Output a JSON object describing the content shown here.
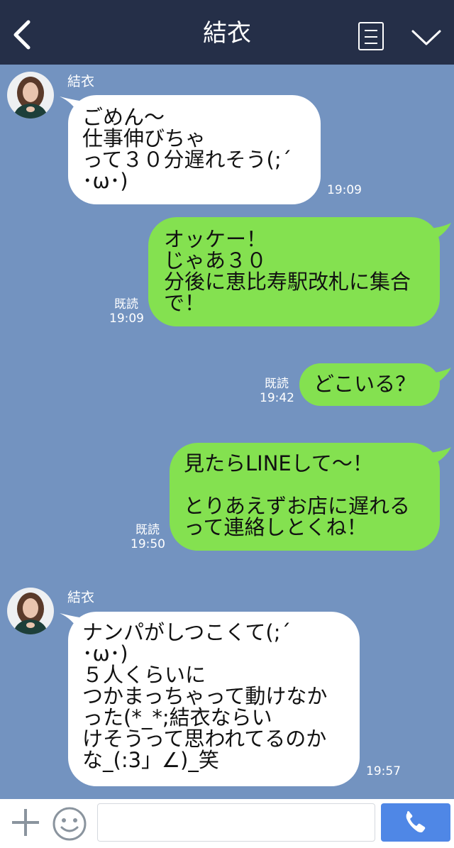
{
  "header": {
    "title": "結衣"
  },
  "messages": [
    {
      "sender": "結衣",
      "text": "ごめん〜\n仕事伸びちゃ\nって３０分遅れそう(;´\n･ω･)",
      "time": "19:09"
    },
    {
      "read": "既読",
      "time": "19:09",
      "text": "オッケー！\nじゃあ３０\n分後に恵比寿駅改札に集合\nで！"
    },
    {
      "read": "既読",
      "time": "19:42",
      "text": "どこいる？"
    },
    {
      "read": "既読",
      "time": "19:50",
      "text": "見たらLINEして〜！\n\nとりあえずお店に遅れる\nって連絡しとくね！"
    },
    {
      "sender": "結衣",
      "text": "ナンパがしつこくて(;´\n･ω･)\n５人くらいに\nつかまっちゃって動けなか\nった(*_*;結衣ならい\nけそうって思われてるのか\nな_(:3」∠)_笑",
      "time": "19:57"
    }
  ],
  "input": {
    "placeholder": ""
  },
  "colors": {
    "background": "#7393c0",
    "header": "#252f48",
    "green_bubble": "#84e150",
    "white_bubble": "#ffffff",
    "call_button": "#4f87e6"
  },
  "icons": {
    "back": "chevron-left-icon",
    "menu": "document-menu-icon",
    "collapse": "chevron-down-icon",
    "add": "plus-icon",
    "emoji": "smiley-icon",
    "call": "phone-icon"
  }
}
